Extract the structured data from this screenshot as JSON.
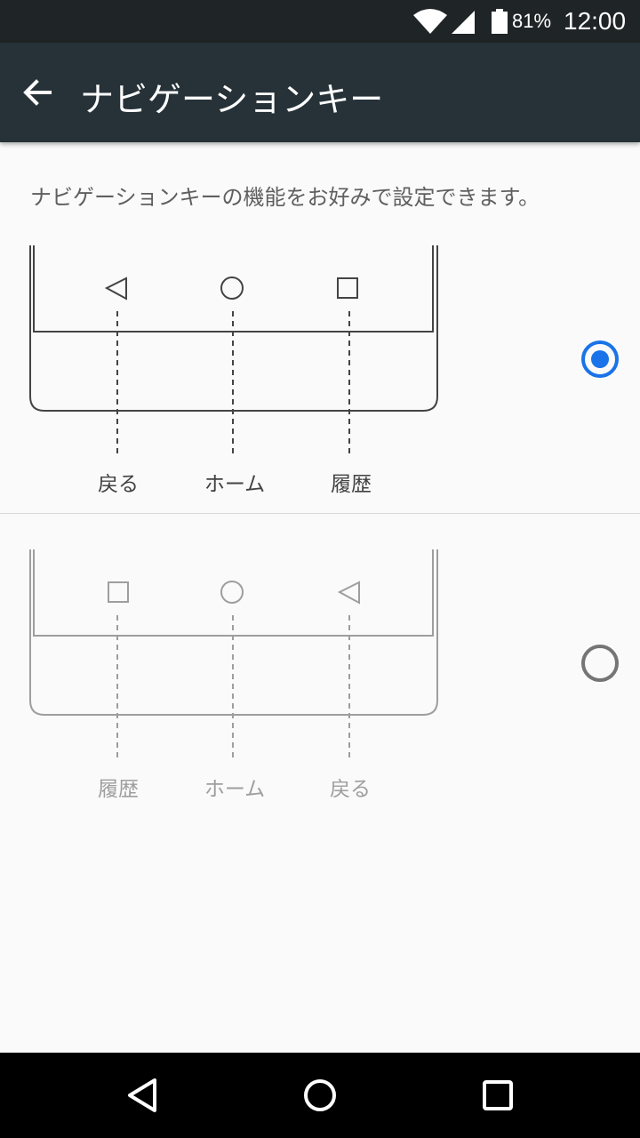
{
  "status_bar": {
    "battery": "81%",
    "time": "12:00",
    "icons": [
      "wifi-icon",
      "signal-icon",
      "battery-icon"
    ]
  },
  "app_bar": {
    "title": "ナビゲーションキー",
    "back_icon": "arrow-back-icon"
  },
  "description": "ナビゲーションキーの機能をお好みで設定できます。",
  "options": [
    {
      "selected": true,
      "keys": [
        {
          "icon": "back-triangle-icon",
          "label": "戻る"
        },
        {
          "icon": "home-circle-icon",
          "label": "ホーム"
        },
        {
          "icon": "recents-square-icon",
          "label": "履歴"
        }
      ]
    },
    {
      "selected": false,
      "keys": [
        {
          "icon": "recents-square-icon",
          "label": "履歴"
        },
        {
          "icon": "home-circle-icon",
          "label": "ホーム"
        },
        {
          "icon": "back-triangle-icon",
          "label": "戻る"
        }
      ]
    }
  ],
  "colors": {
    "accent": "#1a73e8",
    "app_bar": "#263238",
    "status_bar": "#1f2427",
    "background": "#fafafa"
  },
  "nav_bar": {
    "icons": [
      "nav-back-icon",
      "nav-home-icon",
      "nav-recents-icon"
    ]
  }
}
